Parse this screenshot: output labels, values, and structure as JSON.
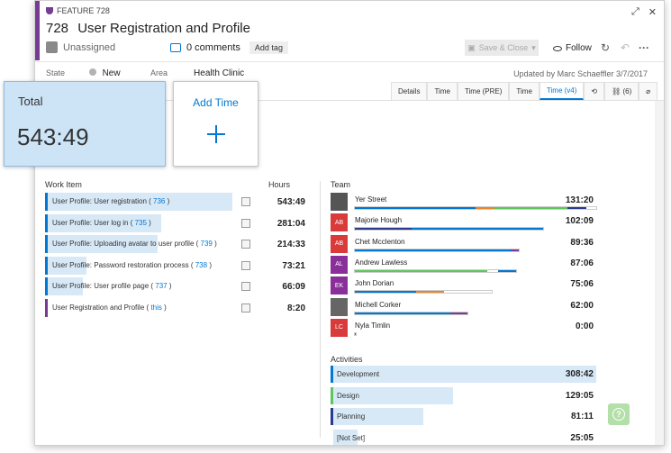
{
  "header": {
    "feature_tag": "FEATURE 728",
    "id": "728",
    "title": "User Registration and Profile",
    "assigned": "Unassigned",
    "comments": "0 comments",
    "add_tag": "Add tag",
    "save_close": "Save & Close",
    "follow": "Follow",
    "accent_color": "#773b93"
  },
  "fields": {
    "state_label": "State",
    "state_value": "New",
    "area_label": "Area",
    "area_value": "Health Clinic",
    "updated": "Updated by Marc Schaeffler 3/7/2017"
  },
  "tabs": [
    {
      "label": "Details"
    },
    {
      "label": "Time"
    },
    {
      "label": "Time (PRE)"
    },
    {
      "label": "Time"
    },
    {
      "label": "Time (v4)"
    },
    {
      "label": "history-icon"
    },
    {
      "label": "(6)"
    },
    {
      "label": "attachment-icon"
    }
  ],
  "total": {
    "label": "Total",
    "value": "543:49"
  },
  "add_time": {
    "label": "Add Time"
  },
  "work_items": {
    "header_item": "Work Item",
    "header_hours": "Hours",
    "rows": [
      {
        "text": "User Profile: User registration",
        "link": "736",
        "hours": "543:49",
        "fill": 1.0,
        "color": "#0078d4"
      },
      {
        "text": "User Profile: User log in",
        "link": "735",
        "hours": "281:04",
        "fill": 0.62,
        "color": "#0078d4"
      },
      {
        "text": "User Profile: Uploading avatar to user profile",
        "link": "739",
        "hours": "214:33",
        "fill": 0.6,
        "color": "#0078d4"
      },
      {
        "text": "User Profile: Password restoration process",
        "link": "738",
        "hours": "73:21",
        "fill": 0.22,
        "color": "#0078d4"
      },
      {
        "text": "User Profile: User profile page",
        "link": "737",
        "hours": "66:09",
        "fill": 0.2,
        "color": "#0078d4"
      },
      {
        "text": "User Registration and Profile",
        "link": "this",
        "hours": "8:20",
        "fill": 0.0,
        "color": "#773b93"
      }
    ]
  },
  "team": {
    "header": "Team",
    "members": [
      {
        "name": "Yer Street",
        "initials": "",
        "avatar_color": "#555555",
        "hours": "131:20",
        "track": 1.0,
        "segments": [
          {
            "w": 0.5,
            "c": "#0078d4"
          },
          {
            "w": 0.08,
            "c": "#e8862d"
          },
          {
            "w": 0.3,
            "c": "#5cc85c"
          },
          {
            "w": 0.08,
            "c": "#2b3a8f"
          }
        ]
      },
      {
        "name": "Majorie Hough",
        "initials": "AB",
        "avatar_color": "#d93a3a",
        "hours": "102:09",
        "track": 0.78,
        "segments": [
          {
            "w": 0.3,
            "c": "#2b3a8f"
          },
          {
            "w": 0.7,
            "c": "#0078d4"
          }
        ]
      },
      {
        "name": "Chet Mcclenton",
        "initials": "AB",
        "avatar_color": "#d93a3a",
        "hours": "89:36",
        "track": 0.68,
        "segments": [
          {
            "w": 0.95,
            "c": "#0078d4"
          },
          {
            "w": 0.05,
            "c": "#773b93"
          }
        ]
      },
      {
        "name": "Andrew Lawless",
        "initials": "AL",
        "avatar_color": "#8a2f9a",
        "hours": "87:06",
        "track": 0.67,
        "segments": [
          {
            "w": 0.82,
            "c": "#5cc85c"
          },
          {
            "w": 0.07,
            "c": "#ffffff"
          },
          {
            "w": 0.11,
            "c": "#0078d4"
          }
        ]
      },
      {
        "name": "John Dorian",
        "initials": "EK",
        "avatar_color": "#8a2f9a",
        "hours": "75:06",
        "track": 0.57,
        "segments": [
          {
            "w": 0.45,
            "c": "#0078d4"
          },
          {
            "w": 0.2,
            "c": "#e8862d"
          }
        ]
      },
      {
        "name": "Michell Corker",
        "initials": "",
        "avatar_color": "#666666",
        "hours": "62:00",
        "track": 0.47,
        "segments": [
          {
            "w": 0.85,
            "c": "#0078d4"
          },
          {
            "w": 0.15,
            "c": "#773b93"
          }
        ]
      },
      {
        "name": "Nyla Timlin",
        "initials": "LC",
        "avatar_color": "#d93a3a",
        "hours": "0:00",
        "track": 0.0,
        "segments": [
          {
            "w": 1.0,
            "c": "#0078d4"
          }
        ]
      }
    ]
  },
  "activities": {
    "header": "Activities",
    "rows": [
      {
        "label": "Development",
        "hours": "308:42",
        "fill": 1.0,
        "color": "#0078d4"
      },
      {
        "label": "Design",
        "hours": "129:05",
        "fill": 0.46,
        "color": "#5cc85c"
      },
      {
        "label": "Planning",
        "hours": "81:11",
        "fill": 0.35,
        "color": "#2b3a8f"
      },
      {
        "label": "[Not Set]",
        "hours": "25:05",
        "fill": 0.1,
        "color": "#ffffff"
      }
    ]
  }
}
